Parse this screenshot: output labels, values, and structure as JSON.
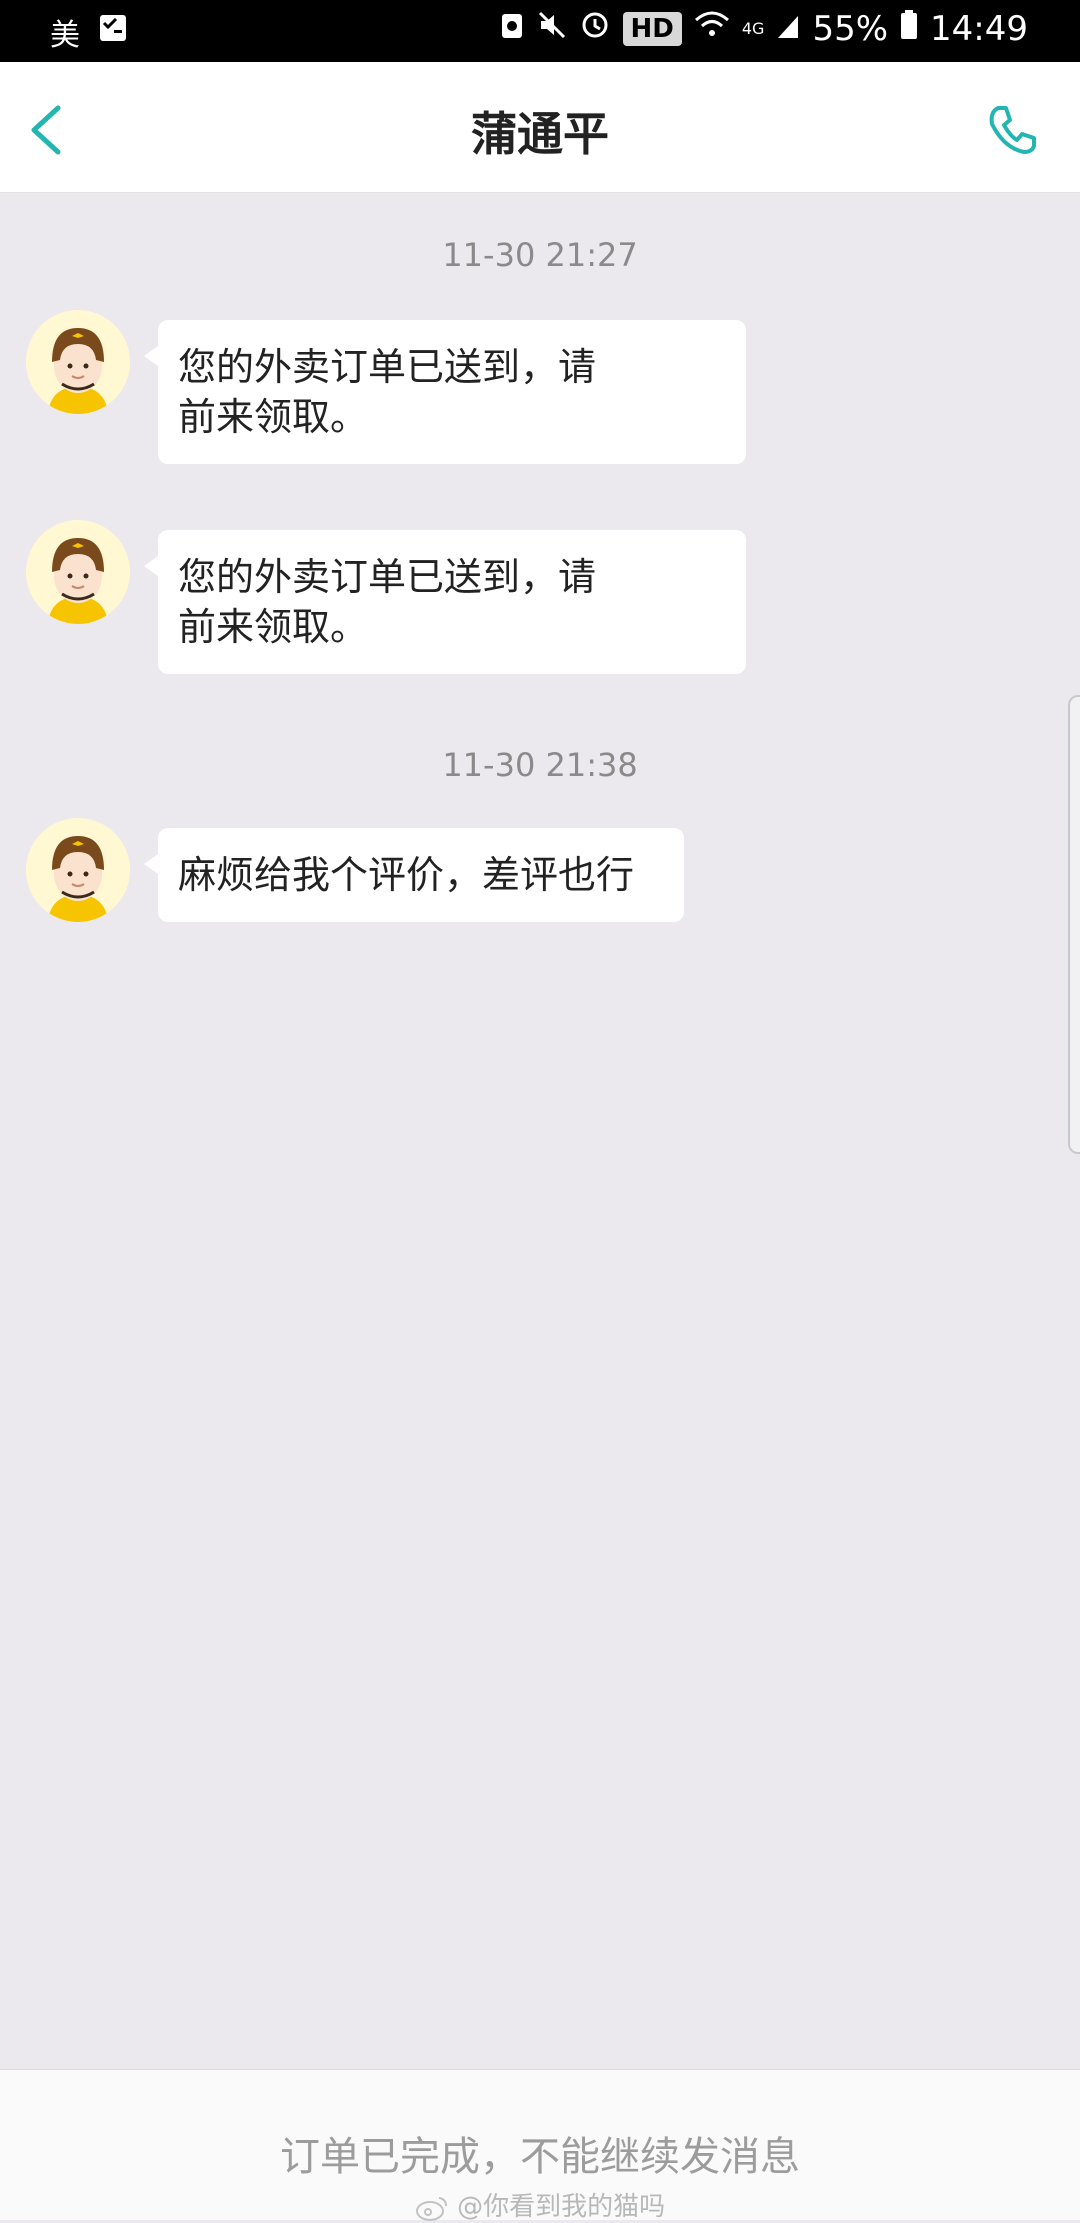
{
  "status_bar": {
    "left_label": "美",
    "battery": "55%",
    "time": "14:49",
    "hd_label": "HD",
    "network_label": "4G"
  },
  "header": {
    "title": "蒲通平"
  },
  "chat": {
    "groups": [
      {
        "timestamp": "11-30 21:27"
      },
      {
        "timestamp": "11-30 21:38"
      }
    ],
    "messages": [
      {
        "line1": "您的外卖订单已送到，请",
        "line2": "前来领取。"
      },
      {
        "line1": "您的外卖订单已送到，请",
        "line2": "前来领取。"
      },
      {
        "text": "麻烦给我个评价，差评也行"
      }
    ]
  },
  "footer": {
    "notice": "订单已完成，不能继续发消息",
    "watermark": "@你看到我的猫吗"
  },
  "colors": {
    "accent": "#23b6b0",
    "background": "#ebe9ee",
    "bubble": "#ffffff",
    "avatar_helmet": "#7a4a1d",
    "avatar_uniform": "#f6c400"
  }
}
